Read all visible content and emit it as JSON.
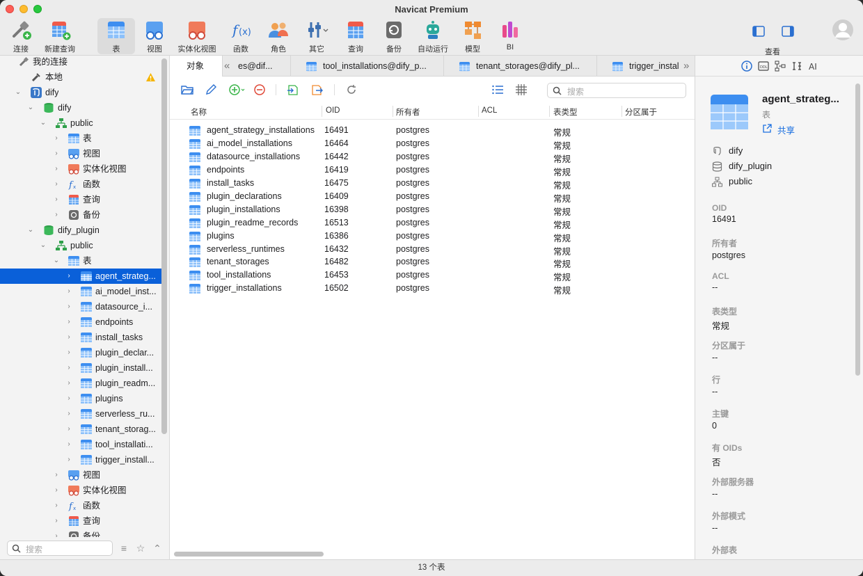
{
  "window": {
    "title": "Navicat Premium"
  },
  "toolbar": {
    "items": [
      {
        "label": "连接",
        "icon": "connect-icon"
      },
      {
        "label": "新建查询",
        "icon": "new-query-icon"
      },
      {
        "label": "表",
        "icon": "table-icon"
      },
      {
        "label": "视图",
        "icon": "view-icon"
      },
      {
        "label": "实体化视图",
        "icon": "materialized-view-icon"
      },
      {
        "label": "函数",
        "icon": "function-icon"
      },
      {
        "label": "角色",
        "icon": "role-icon"
      },
      {
        "label": "其它",
        "icon": "other-icon"
      },
      {
        "label": "查询",
        "icon": "query-icon"
      },
      {
        "label": "备份",
        "icon": "backup-icon"
      },
      {
        "label": "自动运行",
        "icon": "automation-icon"
      },
      {
        "label": "模型",
        "icon": "model-icon"
      },
      {
        "label": "BI",
        "icon": "bi-icon"
      }
    ],
    "view_label": "查看"
  },
  "sidebar": {
    "nodes": [
      {
        "label": "我的连接"
      },
      {
        "label": "本地"
      },
      {
        "label": "dify"
      },
      {
        "label": "dify"
      },
      {
        "label": "public"
      },
      {
        "label": "表"
      },
      {
        "label": "视图"
      },
      {
        "label": "实体化视图"
      },
      {
        "label": "函数"
      },
      {
        "label": "查询"
      },
      {
        "label": "备份"
      },
      {
        "label": "dify_plugin"
      },
      {
        "label": "public"
      },
      {
        "label": "表"
      },
      {
        "label": "agent_strateg..."
      },
      {
        "label": "ai_model_inst..."
      },
      {
        "label": "datasource_i..."
      },
      {
        "label": "endpoints"
      },
      {
        "label": "install_tasks"
      },
      {
        "label": "plugin_declar..."
      },
      {
        "label": "plugin_install..."
      },
      {
        "label": "plugin_readm..."
      },
      {
        "label": "plugins"
      },
      {
        "label": "serverless_ru..."
      },
      {
        "label": "tenant_storag..."
      },
      {
        "label": "tool_installati..."
      },
      {
        "label": "trigger_install..."
      },
      {
        "label": "视图"
      },
      {
        "label": "实体化视图"
      },
      {
        "label": "函数"
      },
      {
        "label": "查询"
      },
      {
        "label": "备份"
      }
    ],
    "search_placeholder": "搜索"
  },
  "tabs": [
    {
      "label": "对象"
    },
    {
      "label": "es@dif..."
    },
    {
      "label": "tool_installations@dify_p..."
    },
    {
      "label": "tenant_storages@dify_pl..."
    },
    {
      "label": "trigger_instal"
    }
  ],
  "object_toolbar": {
    "search_placeholder": "搜索"
  },
  "table": {
    "columns": [
      "名称",
      "OID",
      "所有者",
      "ACL",
      "表类型",
      "分区属于"
    ],
    "rows": [
      {
        "name": "agent_strategy_installations",
        "oid": "16491",
        "owner": "postgres",
        "type": "常规"
      },
      {
        "name": "ai_model_installations",
        "oid": "16464",
        "owner": "postgres",
        "type": "常规"
      },
      {
        "name": "datasource_installations",
        "oid": "16442",
        "owner": "postgres",
        "type": "常规"
      },
      {
        "name": "endpoints",
        "oid": "16419",
        "owner": "postgres",
        "type": "常规"
      },
      {
        "name": "install_tasks",
        "oid": "16475",
        "owner": "postgres",
        "type": "常规"
      },
      {
        "name": "plugin_declarations",
        "oid": "16409",
        "owner": "postgres",
        "type": "常规"
      },
      {
        "name": "plugin_installations",
        "oid": "16398",
        "owner": "postgres",
        "type": "常规"
      },
      {
        "name": "plugin_readme_records",
        "oid": "16513",
        "owner": "postgres",
        "type": "常规"
      },
      {
        "name": "plugins",
        "oid": "16386",
        "owner": "postgres",
        "type": "常规"
      },
      {
        "name": "serverless_runtimes",
        "oid": "16432",
        "owner": "postgres",
        "type": "常规"
      },
      {
        "name": "tenant_storages",
        "oid": "16482",
        "owner": "postgres",
        "type": "常规"
      },
      {
        "name": "tool_installations",
        "oid": "16453",
        "owner": "postgres",
        "type": "常规"
      },
      {
        "name": "trigger_installations",
        "oid": "16502",
        "owner": "postgres",
        "type": "常规"
      }
    ]
  },
  "status": {
    "text": "13 个表"
  },
  "info_panel": {
    "name": "agent_strateg...",
    "type": "表",
    "share_label": "共享",
    "context": [
      {
        "label": "dify",
        "icon": "server-icon"
      },
      {
        "label": "dify_plugin",
        "icon": "database-icon"
      },
      {
        "label": "public",
        "icon": "schema-icon"
      }
    ],
    "properties": [
      {
        "key": "OID",
        "value": "16491"
      },
      {
        "key": "所有者",
        "value": "postgres"
      },
      {
        "key": "ACL",
        "value": "--"
      },
      {
        "key": "表类型",
        "value": "常规"
      },
      {
        "key": "分区属于",
        "value": "--"
      },
      {
        "key": "行",
        "value": "--"
      },
      {
        "key": "主键",
        "value": "0"
      },
      {
        "key": "有 OIDs",
        "value": "否"
      },
      {
        "key": "外部服务器",
        "value": "--"
      },
      {
        "key": "外部模式",
        "value": "--"
      },
      {
        "key": "外部表",
        "value": ""
      }
    ]
  },
  "colors": {
    "accent": "#0a60d9",
    "link": "#1a6fe0",
    "table_icon": "#3d8ef0"
  }
}
